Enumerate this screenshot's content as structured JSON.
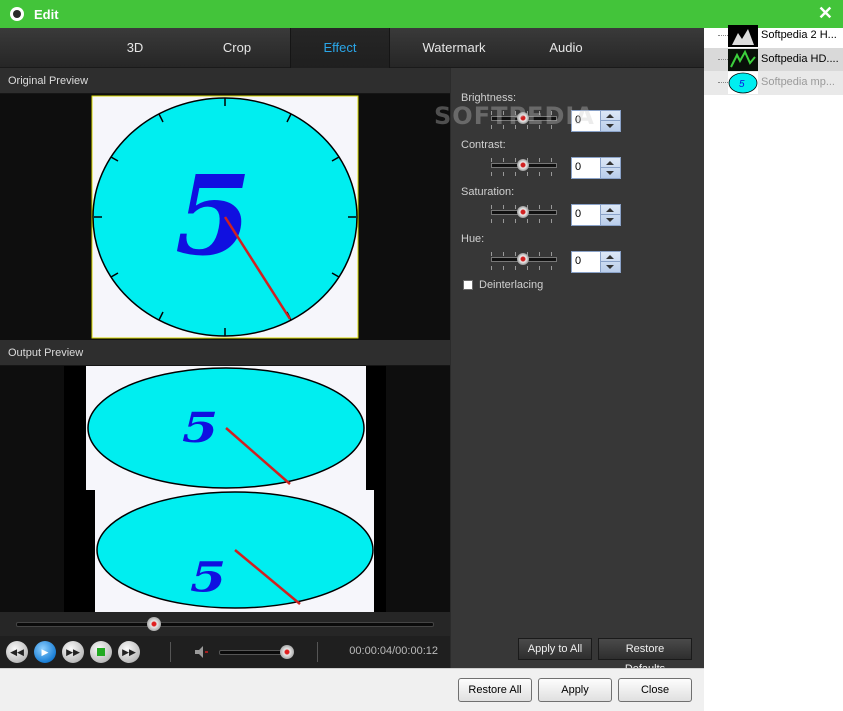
{
  "window": {
    "title": "Edit",
    "close_glyph": "✕",
    "accent": "#43c43a"
  },
  "tabs": [
    {
      "label": "3D"
    },
    {
      "label": "Crop"
    },
    {
      "label": "Effect"
    },
    {
      "label": "Watermark"
    },
    {
      "label": "Audio"
    }
  ],
  "active_tab": "Effect",
  "preview": {
    "original_label": "Original Preview",
    "output_label": "Output Preview",
    "clock_digit": "5"
  },
  "playback": {
    "time": "00:00:04/00:00:12",
    "seek_fraction": 0.33,
    "volume_fraction": 0.9,
    "buttons": [
      "rewind",
      "play",
      "fast-forward",
      "stop",
      "next"
    ]
  },
  "effects": {
    "brightness": {
      "label": "Brightness:",
      "value": "0"
    },
    "contrast": {
      "label": "Contrast:",
      "value": "0"
    },
    "saturation": {
      "label": "Saturation:",
      "value": "0"
    },
    "hue": {
      "label": "Hue:",
      "value": "0"
    },
    "deinterlacing_label": "Deinterlacing",
    "apply_all": "Apply to All",
    "restore_defaults": "Restore Defaults"
  },
  "footer": {
    "restore_all": "Restore All",
    "apply": "Apply",
    "close": "Close"
  },
  "files": [
    {
      "name": "Softpedia 2 H...",
      "selected": false,
      "dim": false
    },
    {
      "name": "Softpedia HD....",
      "selected": true,
      "dim": false
    },
    {
      "name": "Softpedia mp...",
      "selected": false,
      "dim": true
    }
  ],
  "watermark_text": "SOFTPEDIA"
}
